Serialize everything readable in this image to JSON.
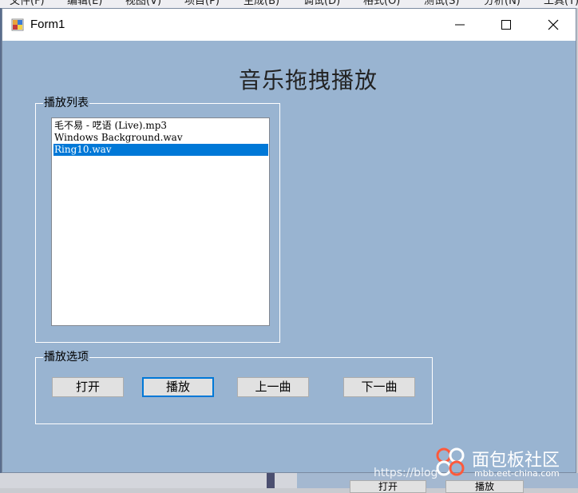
{
  "background": {
    "menu": [
      "文件(F)",
      "编辑(E)",
      "视图(V)",
      "项目(P)",
      "生成(B)",
      "调试(D)",
      "格式(O)",
      "测试(S)",
      "分析(N)",
      "工具(T)"
    ],
    "bottom_buttons": [
      "打开",
      "播放"
    ]
  },
  "window": {
    "title": "Form1",
    "controls": {
      "minimize": "minimize-icon",
      "maximize": "maximize-icon",
      "close": "close-icon"
    }
  },
  "heading": "音乐拖拽播放",
  "playlist": {
    "label": "播放列表",
    "items": [
      "毛不易 - 呓语 (Live).mp3",
      "Windows Background.wav",
      "Ring10.wav"
    ],
    "selected_index": 2
  },
  "options": {
    "label": "播放选项",
    "buttons": {
      "open": "打开",
      "play": "播放",
      "prev": "上一曲",
      "next": "下一曲"
    }
  },
  "watermark": {
    "url": "https://blog",
    "brand": "面包板社区",
    "site": "mbb.eet-china.com"
  },
  "colors": {
    "form_background": "#99b4d1",
    "selection": "#0078d7",
    "button_face": "#e1e1e1"
  }
}
